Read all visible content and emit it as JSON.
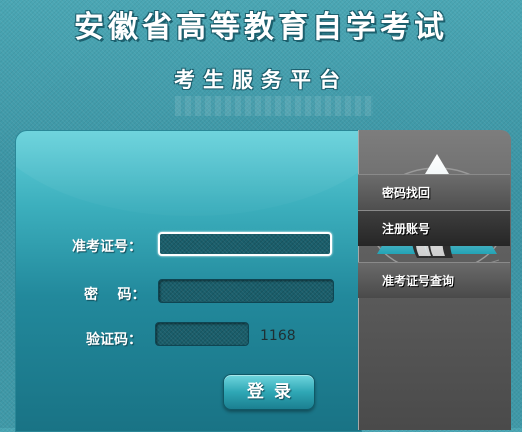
{
  "header": {
    "title": "安徽省高等教育自学考试",
    "subtitle": "考生服务平台"
  },
  "login": {
    "admission_label": "准考证号：",
    "admission_value": "",
    "password_label": "密    码：",
    "password_value": "",
    "captcha_label": "验证码：",
    "captcha_value": "",
    "captcha_code": "1168",
    "submit_label": "登录"
  },
  "sidebar": {
    "logo_icon": "exam-authority-triangle-logo-icon",
    "links": [
      {
        "label": "密码找回"
      },
      {
        "label": "注册账号"
      },
      {
        "label": "准考证号查询"
      }
    ]
  },
  "colors": {
    "background": "#3c97a7",
    "panel_accent": "#3cafbd",
    "sidebar": "#5f5f5f"
  }
}
